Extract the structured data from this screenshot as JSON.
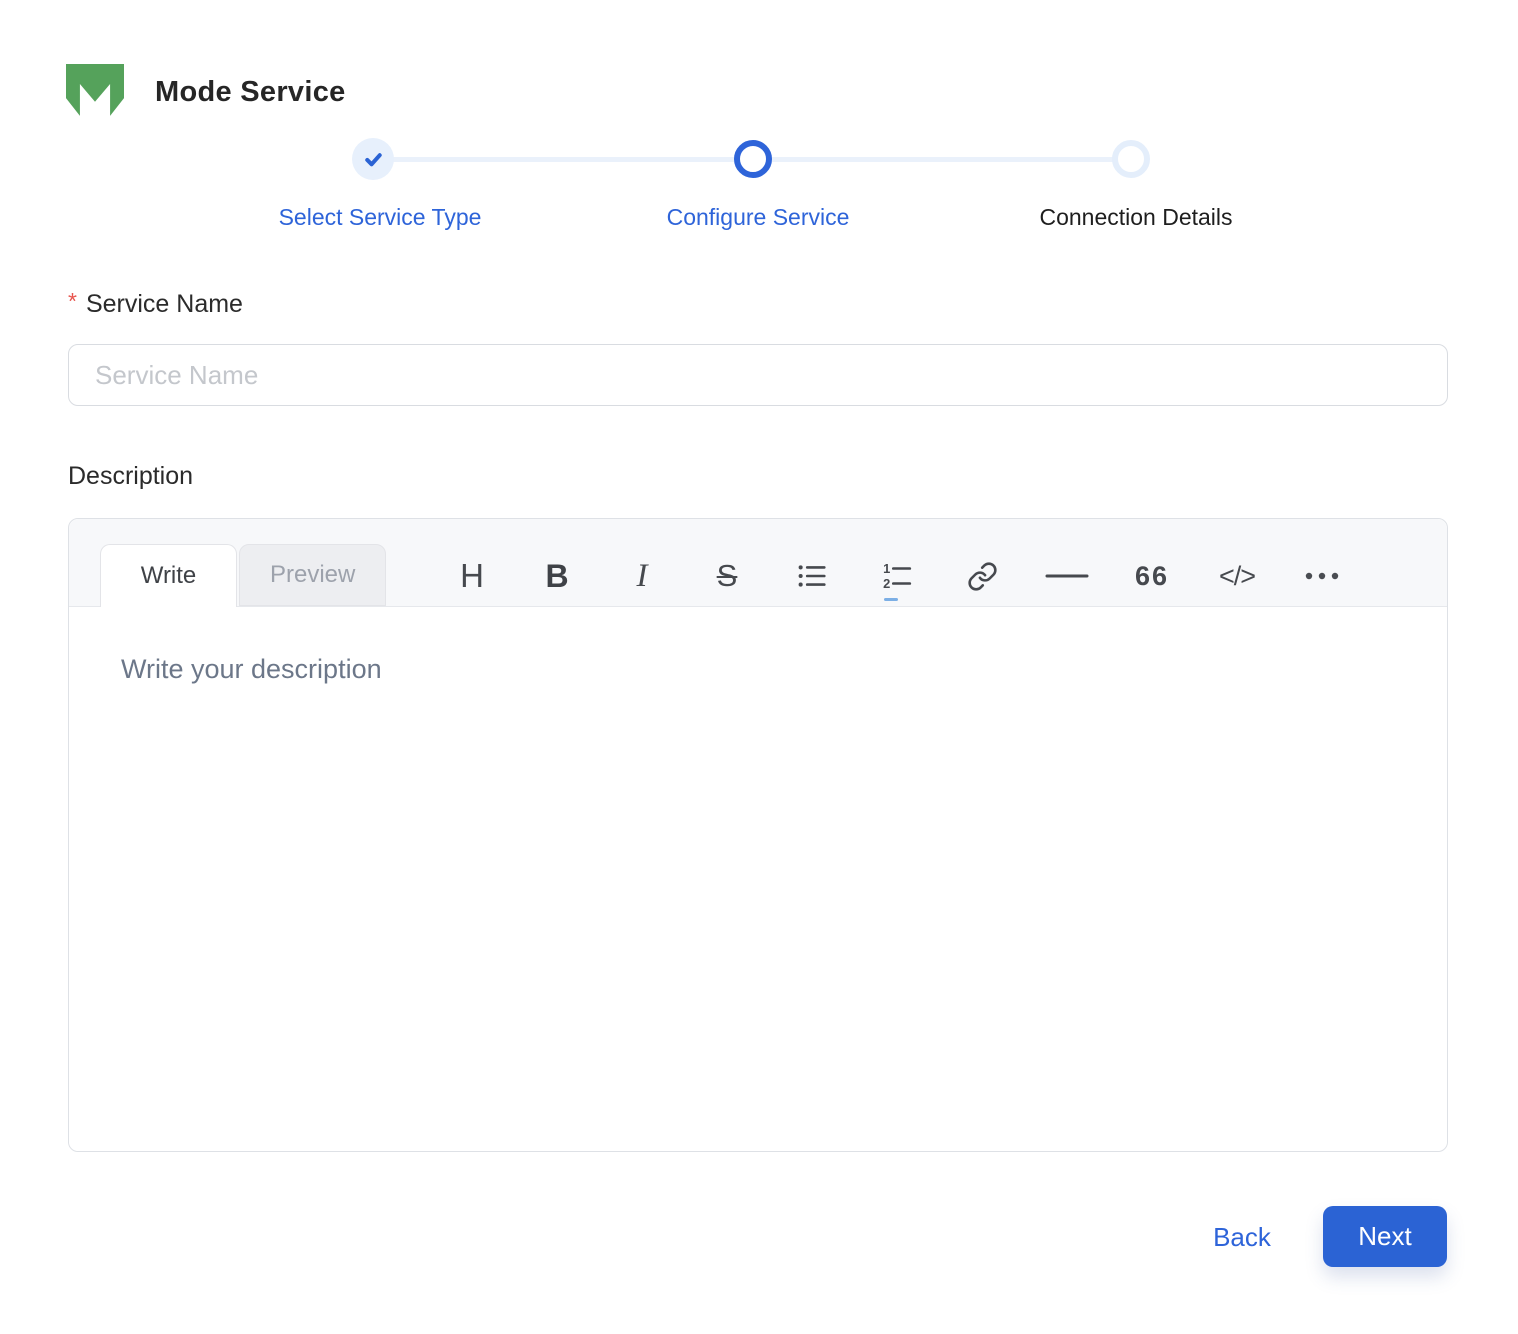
{
  "header": {
    "title": "Mode Service",
    "logo_icon": "mode-logo-icon"
  },
  "stepper": {
    "steps": [
      {
        "label": "Select Service Type",
        "state": "completed",
        "icon": "check-icon"
      },
      {
        "label": "Configure Service",
        "state": "active",
        "icon": "ring-icon"
      },
      {
        "label": "Connection Details",
        "state": "pending",
        "icon": "ring-icon"
      }
    ]
  },
  "form": {
    "service_name": {
      "label": "Service Name",
      "required_marker": "*",
      "placeholder": "Service Name",
      "value": ""
    },
    "description_label": "Description"
  },
  "editor": {
    "tabs": [
      {
        "label": "Write",
        "active": true
      },
      {
        "label": "Preview",
        "active": false
      }
    ],
    "toolbar": [
      {
        "name": "heading-icon",
        "glyph": "H"
      },
      {
        "name": "bold-icon",
        "glyph": "B"
      },
      {
        "name": "italic-icon",
        "glyph": "I"
      },
      {
        "name": "strikethrough-icon",
        "glyph": "S"
      },
      {
        "name": "unordered-list-icon"
      },
      {
        "name": "ordered-list-icon"
      },
      {
        "name": "link-icon"
      },
      {
        "name": "horizontal-rule-icon"
      },
      {
        "name": "quote-icon",
        "glyph": "66"
      },
      {
        "name": "code-icon",
        "glyph": "</>"
      },
      {
        "name": "more-icon"
      }
    ],
    "placeholder": "Write your description",
    "value": ""
  },
  "footer": {
    "back_label": "Back",
    "next_label": "Next"
  },
  "colors": {
    "primary_blue": "#2B63D4",
    "pale_blue": "#E7F0FC",
    "logo_green": "#55A25B",
    "required_red": "#E8554E",
    "header_bg": "#F7F8FA"
  }
}
